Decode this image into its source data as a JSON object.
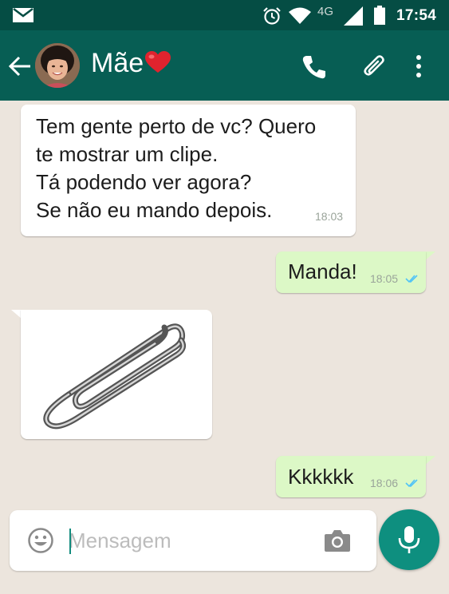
{
  "status_bar": {
    "icons": [
      "mail-icon",
      "alarm-icon",
      "wifi-icon",
      "signal-icon",
      "battery-icon"
    ],
    "network": "4G",
    "time": "17:54"
  },
  "header": {
    "contact_name": "Mãe",
    "icons": [
      "back-arrow-icon",
      "avatar",
      "heart-emoji",
      "phone-icon",
      "paperclip-icon",
      "more-vert-icon"
    ]
  },
  "messages": [
    {
      "direction": "incoming",
      "lines": [
        "Tem gente perto de vc? Quero",
        "te mostrar um clipe.",
        "Tá podendo ver agora?",
        "Se não eu mando depois."
      ],
      "time": "18:03"
    },
    {
      "direction": "outgoing",
      "text": "Manda!",
      "time": "18:05",
      "status": "read"
    },
    {
      "direction": "incoming",
      "type": "image",
      "image": "paperclip-image"
    },
    {
      "direction": "outgoing",
      "text": "Kkkkkk",
      "time": "18:06",
      "status": "read"
    }
  ],
  "compose": {
    "placeholder": "Mensagem",
    "icons": [
      "emoji-icon",
      "camera-icon",
      "mic-icon"
    ]
  },
  "colors": {
    "status_bar": "#054d44",
    "app_bar": "#075e54",
    "chat_background": "#ece5dd",
    "outgoing_bubble": "#dcf8c6",
    "incoming_bubble": "#ffffff",
    "read_ticks": "#4fc3f7",
    "mic_button": "#0e8f7f"
  }
}
